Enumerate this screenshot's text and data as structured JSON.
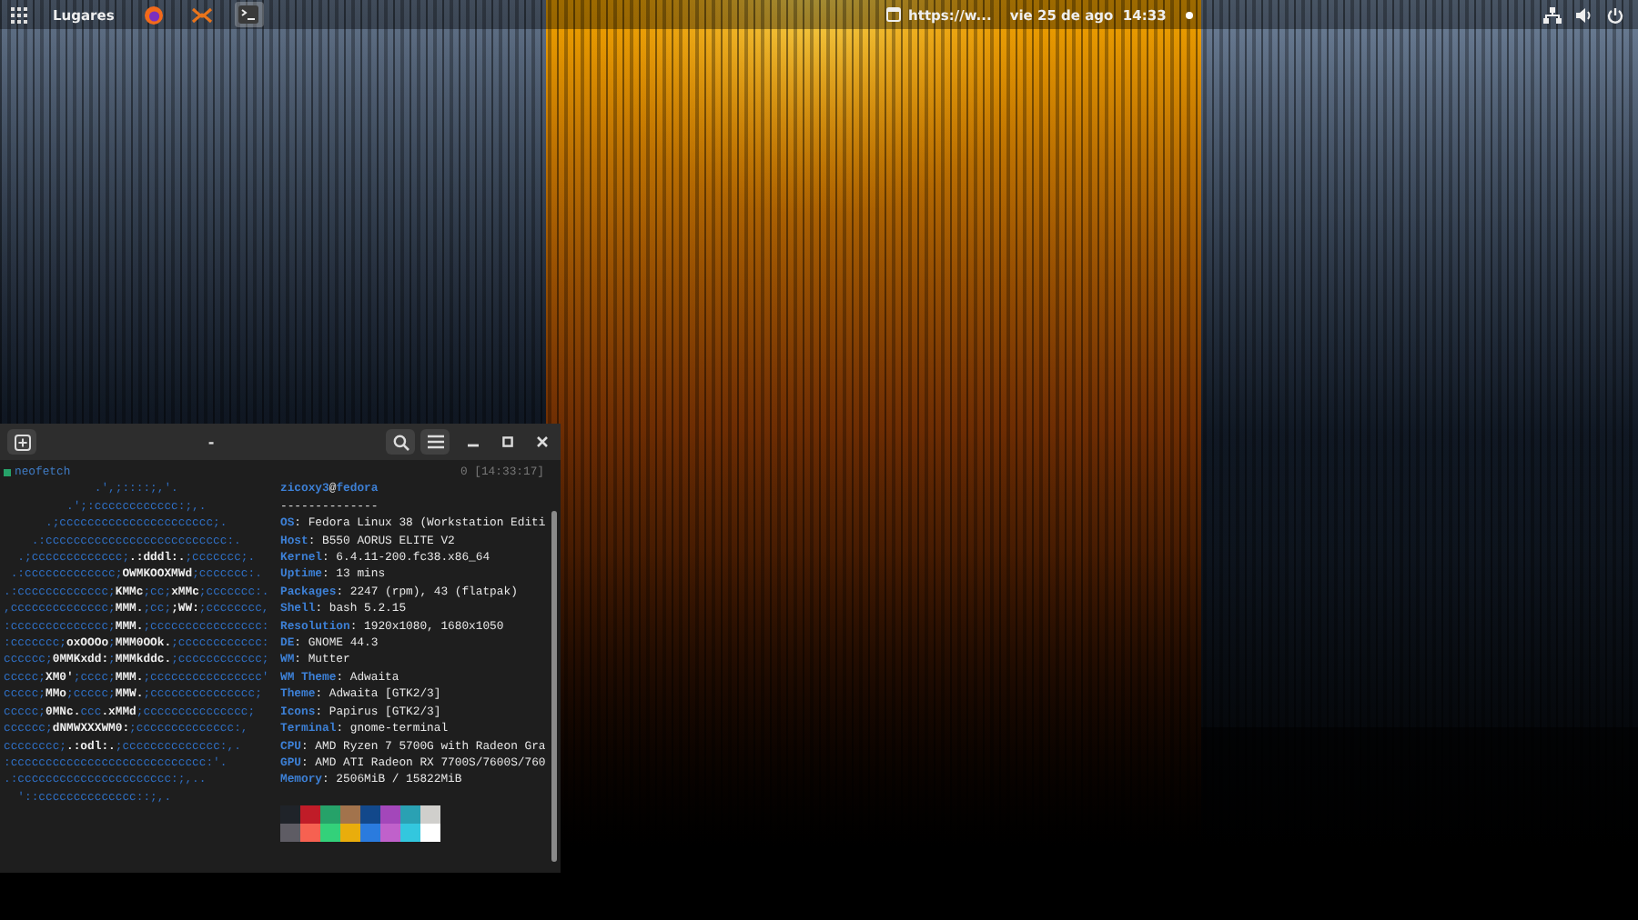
{
  "top_bar": {
    "activities": {
      "kind": "grid"
    },
    "places": "Lugares",
    "apps": [
      {
        "kind": "firefox",
        "selected": false
      },
      {
        "kind": "cross",
        "selected": false
      },
      {
        "kind": "terminal",
        "selected": true
      }
    ],
    "window_title": "https://w...",
    "clock": "vie 25 de ago  14:33"
  },
  "terminal": {
    "title": "-",
    "prompt": {
      "command": "neofetch",
      "status": "0 [14:33:17]"
    },
    "logo": [
      [
        {
          "kind": "fill",
          "text": "             .',;::::;,'."
        }
      ],
      [
        {
          "kind": "fill",
          "text": "         .';:cccccccccccc:;,."
        }
      ],
      [
        {
          "kind": "fill",
          "text": "      .;cccccccccccccccccccccc;."
        }
      ],
      [
        {
          "kind": "fill",
          "text": "    .:cccccccccccccccccccccccccc:."
        }
      ],
      [
        {
          "kind": "fill",
          "text": "  .;ccccccccccccc;"
        },
        {
          "kind": "letter",
          "text": ".:dddl:."
        },
        {
          "kind": "fill",
          "text": ";ccccccc;."
        }
      ],
      [
        {
          "kind": "fill",
          "text": " .:ccccccccccccc;"
        },
        {
          "kind": "letter",
          "text": "OWMKOOXMWd"
        },
        {
          "kind": "fill",
          "text": ";ccccccc:."
        }
      ],
      [
        {
          "kind": "fill",
          "text": ".:ccccccccccccc;"
        },
        {
          "kind": "letter",
          "text": "KMMc"
        },
        {
          "kind": "fill",
          "text": ";cc;"
        },
        {
          "kind": "letter",
          "text": "xMMc"
        },
        {
          "kind": "fill",
          "text": ";ccccccc:."
        }
      ],
      [
        {
          "kind": "fill",
          "text": ",cccccccccccccc;"
        },
        {
          "kind": "letter",
          "text": "MMM."
        },
        {
          "kind": "fill",
          "text": ";cc;"
        },
        {
          "kind": "letter",
          "text": ";WW:"
        },
        {
          "kind": "fill",
          "text": ";cccccccc,"
        }
      ],
      [
        {
          "kind": "fill",
          "text": ":cccccccccccccc;"
        },
        {
          "kind": "letter",
          "text": "MMM."
        },
        {
          "kind": "fill",
          "text": ";cccccccccccccccc:"
        }
      ],
      [
        {
          "kind": "fill",
          "text": ":ccccccc;"
        },
        {
          "kind": "letter",
          "text": "oxOOOo"
        },
        {
          "kind": "fill",
          "text": ";"
        },
        {
          "kind": "letter",
          "text": "MMM0OOk."
        },
        {
          "kind": "fill",
          "text": ";cccccccccccc:"
        }
      ],
      [
        {
          "kind": "fill",
          "text": "cccccc;"
        },
        {
          "kind": "letter",
          "text": "0MMKxdd:"
        },
        {
          "kind": "fill",
          "text": ";"
        },
        {
          "kind": "letter",
          "text": "MMMkddc."
        },
        {
          "kind": "fill",
          "text": ";cccccccccccc;"
        }
      ],
      [
        {
          "kind": "fill",
          "text": "ccccc;"
        },
        {
          "kind": "letter",
          "text": "XM0'"
        },
        {
          "kind": "fill",
          "text": ";cccc;"
        },
        {
          "kind": "letter",
          "text": "MMM."
        },
        {
          "kind": "fill",
          "text": ";cccccccccccccccc'"
        }
      ],
      [
        {
          "kind": "fill",
          "text": "ccccc;"
        },
        {
          "kind": "letter",
          "text": "MMo"
        },
        {
          "kind": "fill",
          "text": ";ccccc;"
        },
        {
          "kind": "letter",
          "text": "MMW."
        },
        {
          "kind": "fill",
          "text": ";ccccccccccccccc;"
        }
      ],
      [
        {
          "kind": "fill",
          "text": "ccccc;"
        },
        {
          "kind": "letter",
          "text": "0MNc."
        },
        {
          "kind": "fill",
          "text": "ccc"
        },
        {
          "kind": "letter",
          "text": ".xMMd"
        },
        {
          "kind": "fill",
          "text": ";ccccccccccccccc;"
        }
      ],
      [
        {
          "kind": "fill",
          "text": "cccccc;"
        },
        {
          "kind": "letter",
          "text": "dNMWXXXWM0:"
        },
        {
          "kind": "fill",
          "text": ";cccccccccccccc:,"
        }
      ],
      [
        {
          "kind": "fill",
          "text": "cccccccc;"
        },
        {
          "kind": "letter",
          "text": ".:odl:."
        },
        {
          "kind": "fill",
          "text": ";cccccccccccccc:,."
        }
      ],
      [
        {
          "kind": "fill",
          "text": ":cccccccccccccccccccccccccccc:'."
        }
      ],
      [
        {
          "kind": "fill",
          "text": ".:cccccccccccccccccccccc:;,.."
        }
      ],
      [
        {
          "kind": "fill",
          "text": "  '::cccccccccccccc::;,."
        }
      ]
    ],
    "info": [
      {
        "kind": "title",
        "user": "zicoxy3",
        "at": "@",
        "host": "fedora"
      },
      {
        "kind": "rule",
        "text": "--------------"
      },
      {
        "kind": "field",
        "label": "OS",
        "value": ": Fedora Linux 38 (Workstation Editi"
      },
      {
        "kind": "field",
        "label": "Host",
        "value": ": B550 AORUS ELITE V2"
      },
      {
        "kind": "field",
        "label": "Kernel",
        "value": ": 6.4.11-200.fc38.x86_64"
      },
      {
        "kind": "field",
        "label": "Uptime",
        "value": ": 13 mins"
      },
      {
        "kind": "field",
        "label": "Packages",
        "value": ": 2247 (rpm), 43 (flatpak)"
      },
      {
        "kind": "field",
        "label": "Shell",
        "value": ": bash 5.2.15"
      },
      {
        "kind": "field",
        "label": "Resolution",
        "value": ": 1920x1080, 1680x1050"
      },
      {
        "kind": "field",
        "label": "DE",
        "value": ": GNOME 44.3"
      },
      {
        "kind": "field",
        "label": "WM",
        "value": ": Mutter"
      },
      {
        "kind": "field",
        "label": "WM Theme",
        "value": ": Adwaita"
      },
      {
        "kind": "field",
        "label": "Theme",
        "value": ": Adwaita [GTK2/3]"
      },
      {
        "kind": "field",
        "label": "Icons",
        "value": ": Papirus [GTK2/3]"
      },
      {
        "kind": "field",
        "label": "Terminal",
        "value": ": gnome-terminal"
      },
      {
        "kind": "field",
        "label": "CPU",
        "value": ": AMD Ryzen 7 5700G with Radeon Gra"
      },
      {
        "kind": "field",
        "label": "GPU",
        "value": ": AMD ATI Radeon RX 7700S/7600S/760"
      },
      {
        "kind": "field",
        "label": "Memory",
        "value": ": 2506MiB / 15822MiB"
      }
    ],
    "palette": [
      [
        {
          "color": "#1f2329"
        },
        {
          "color": "#c01c28"
        },
        {
          "color": "#26a269"
        },
        {
          "color": "#a2734c"
        },
        {
          "color": "#12488b"
        },
        {
          "color": "#a347ba"
        },
        {
          "color": "#2aa1b3"
        },
        {
          "color": "#d0cfcc"
        }
      ],
      [
        {
          "color": "#5e5c64"
        },
        {
          "color": "#f66151"
        },
        {
          "color": "#33d17a"
        },
        {
          "color": "#e9ad0c"
        },
        {
          "color": "#2a7bde"
        },
        {
          "color": "#c061cb"
        },
        {
          "color": "#33c7de"
        },
        {
          "color": "#ffffff"
        }
      ]
    ]
  }
}
